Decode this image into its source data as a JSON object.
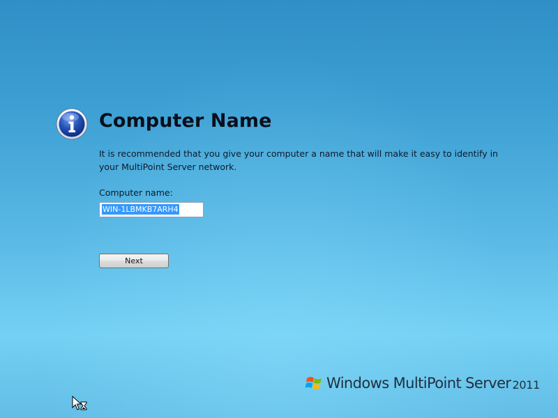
{
  "page": {
    "title": "Computer Name",
    "description": "It is recommended that you give your computer a name that will make it easy to identify in your MultiPoint Server network.",
    "icon": "info-icon"
  },
  "form": {
    "computer_name_label": "Computer name:",
    "computer_name_value": "WIN-1LBMKB7ARH4",
    "next_label": "Next"
  },
  "branding": {
    "product": "Windows MultiPoint Server",
    "year": "2011",
    "logo": "windows-flag-icon"
  },
  "cursor": "busy-pointer-icon",
  "colors": {
    "background_top": "#2f8fc6",
    "background_bottom": "#74d0f4",
    "selection": "#3399ff",
    "icon_blue": "#1f4fb4"
  }
}
